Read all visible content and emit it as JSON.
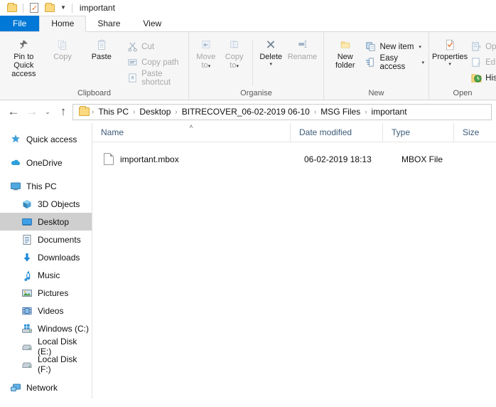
{
  "window": {
    "title": "important",
    "quick_access": [
      {
        "name": "folder-icon",
        "label": "Folder"
      },
      {
        "name": "properties-icon",
        "label": "Properties"
      },
      {
        "name": "new-folder-icon",
        "label": "New folder"
      }
    ],
    "customize_caret": "▼"
  },
  "tabs": [
    {
      "id": "file",
      "label": "File"
    },
    {
      "id": "home",
      "label": "Home"
    },
    {
      "id": "share",
      "label": "Share"
    },
    {
      "id": "view",
      "label": "View"
    }
  ],
  "ribbon": {
    "groups": [
      {
        "id": "clipboard",
        "label": "Clipboard",
        "big": [
          {
            "id": "pin-to-quick-access",
            "label": "Pin to Quick\naccess",
            "line1": "Pin to Quick",
            "line2": "access",
            "disabled": false
          },
          {
            "id": "copy",
            "label": "Copy",
            "line1": "Copy",
            "line2": "",
            "disabled": true
          },
          {
            "id": "paste",
            "label": "Paste",
            "line1": "Paste",
            "line2": "",
            "disabled": false
          }
        ],
        "small": [
          {
            "id": "cut",
            "label": "Cut",
            "disabled": true
          },
          {
            "id": "copy-path",
            "label": "Copy path",
            "disabled": true
          },
          {
            "id": "paste-shortcut",
            "label": "Paste shortcut",
            "disabled": true
          }
        ]
      },
      {
        "id": "organise",
        "label": "Organise",
        "big": [
          {
            "id": "move-to",
            "line1": "Move",
            "line2": "to",
            "caret": "▾",
            "disabled": true
          },
          {
            "id": "copy-to",
            "line1": "Copy",
            "line2": "to",
            "caret": "▾",
            "disabled": true
          },
          {
            "id": "delete",
            "line1": "Delete",
            "line2": "",
            "caret": "▾",
            "disabled": false
          },
          {
            "id": "rename",
            "line1": "Rename",
            "line2": "",
            "disabled": true
          }
        ]
      },
      {
        "id": "new",
        "label": "New",
        "big": [
          {
            "id": "new-folder",
            "line1": "New",
            "line2": "folder",
            "disabled": false
          }
        ],
        "small": [
          {
            "id": "new-item",
            "label": "New item",
            "caret": "▾",
            "disabled": false
          },
          {
            "id": "easy-access",
            "label": "Easy access",
            "caret": "▾",
            "disabled": false
          }
        ]
      },
      {
        "id": "open",
        "label": "Open",
        "big": [
          {
            "id": "properties",
            "line1": "Properties",
            "line2": "",
            "caret": "▾",
            "disabled": false
          }
        ],
        "small": [
          {
            "id": "open",
            "label": "Op",
            "disabled": true
          },
          {
            "id": "edit",
            "label": "Edi",
            "disabled": true
          },
          {
            "id": "history",
            "label": "His",
            "disabled": false
          }
        ]
      }
    ]
  },
  "addressbar": {
    "back": "←",
    "forward": "→",
    "recent": "⌄",
    "up": "↑",
    "crumbs": [
      "This PC",
      "Desktop",
      "BITRECOVER_06-02-2019 06-10",
      "MSG Files",
      "important"
    ],
    "separator": "›"
  },
  "navpane": {
    "items": [
      {
        "id": "quick-access",
        "label": "Quick access",
        "icon": "star-icon",
        "indent": false,
        "selected": false
      },
      {
        "id": "onedrive",
        "label": "OneDrive",
        "icon": "cloud-icon",
        "indent": false,
        "selected": false
      },
      {
        "id": "this-pc",
        "label": "This PC",
        "icon": "monitor-icon",
        "indent": false,
        "selected": false
      },
      {
        "id": "3d-objects",
        "label": "3D Objects",
        "icon": "cube-icon",
        "indent": true,
        "selected": false
      },
      {
        "id": "desktop",
        "label": "Desktop",
        "icon": "desktop-icon",
        "indent": true,
        "selected": true
      },
      {
        "id": "documents",
        "label": "Documents",
        "icon": "documents-icon",
        "indent": true,
        "selected": false
      },
      {
        "id": "downloads",
        "label": "Downloads",
        "icon": "download-icon",
        "indent": true,
        "selected": false
      },
      {
        "id": "music",
        "label": "Music",
        "icon": "music-icon",
        "indent": true,
        "selected": false
      },
      {
        "id": "pictures",
        "label": "Pictures",
        "icon": "pictures-icon",
        "indent": true,
        "selected": false
      },
      {
        "id": "videos",
        "label": "Videos",
        "icon": "videos-icon",
        "indent": true,
        "selected": false
      },
      {
        "id": "windows-c",
        "label": "Windows (C:)",
        "icon": "windows-drive-icon",
        "indent": true,
        "selected": false
      },
      {
        "id": "local-disk-e",
        "label": "Local Disk (E:)",
        "icon": "drive-icon",
        "indent": true,
        "selected": false
      },
      {
        "id": "local-disk-f",
        "label": "Local Disk (F:)",
        "icon": "drive-icon",
        "indent": true,
        "selected": false
      },
      {
        "id": "network",
        "label": "Network",
        "icon": "network-icon",
        "indent": false,
        "selected": false
      }
    ]
  },
  "filelist": {
    "columns": [
      {
        "id": "name",
        "label": "Name",
        "sorted": true,
        "sort_mark": "˄"
      },
      {
        "id": "date-modified",
        "label": "Date modified",
        "sorted": false
      },
      {
        "id": "type",
        "label": "Type",
        "sorted": false
      },
      {
        "id": "size",
        "label": "Size",
        "sorted": false
      }
    ],
    "rows": [
      {
        "name": "important.mbox",
        "date_modified": "06-02-2019 18:13",
        "type": "MBOX File",
        "size": "",
        "icon": "file-icon"
      }
    ]
  },
  "colors": {
    "accent": "#0078d7",
    "ribbon_bg": "#f6f6f6",
    "selection": "#cfcfcf",
    "column_header_text": "#3b5b78",
    "folder_yellow": "#fbd980"
  }
}
